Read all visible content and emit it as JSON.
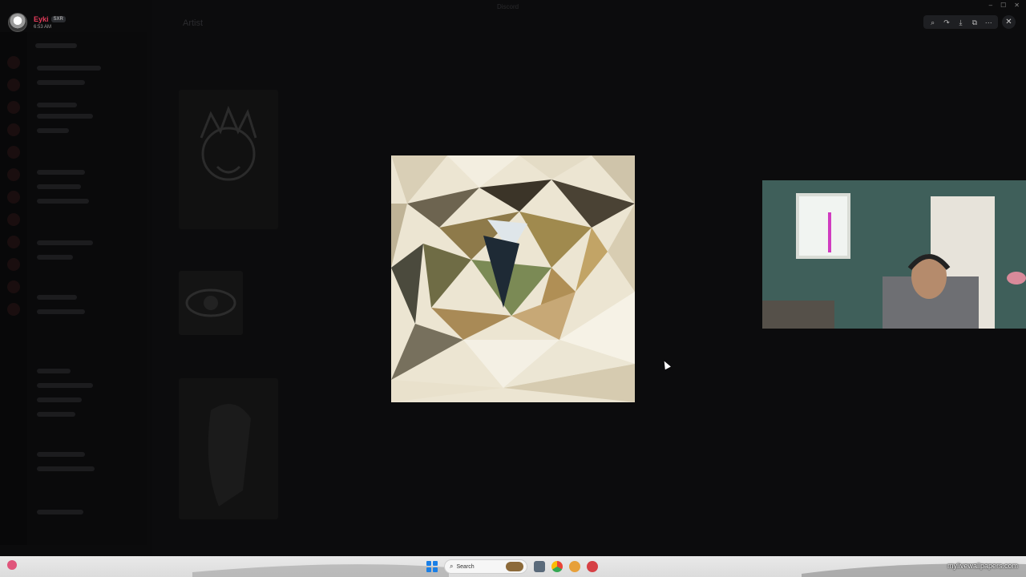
{
  "app": {
    "window_title": "Discord",
    "user": {
      "name": "Eyki",
      "badge": "SXR",
      "time": "6:53 AM"
    },
    "channel_title": "Artist"
  },
  "viewer": {
    "tools": [
      {
        "name": "zoom-icon",
        "glyph": "⌕"
      },
      {
        "name": "forward-icon",
        "glyph": "↷"
      },
      {
        "name": "download-icon",
        "glyph": "⤓"
      },
      {
        "name": "open-external-icon",
        "glyph": "⧉"
      },
      {
        "name": "more-icon",
        "glyph": "⋯"
      }
    ],
    "close_glyph": "✕"
  },
  "window_controls": {
    "minimize": "–",
    "maximize": "☐",
    "close": "✕"
  },
  "taskbar": {
    "search_placeholder": "Search",
    "watermark": "mylivewallpapers.com"
  },
  "colors": {
    "username": "#e23b5a",
    "start_blue": "#1a7fe6"
  }
}
